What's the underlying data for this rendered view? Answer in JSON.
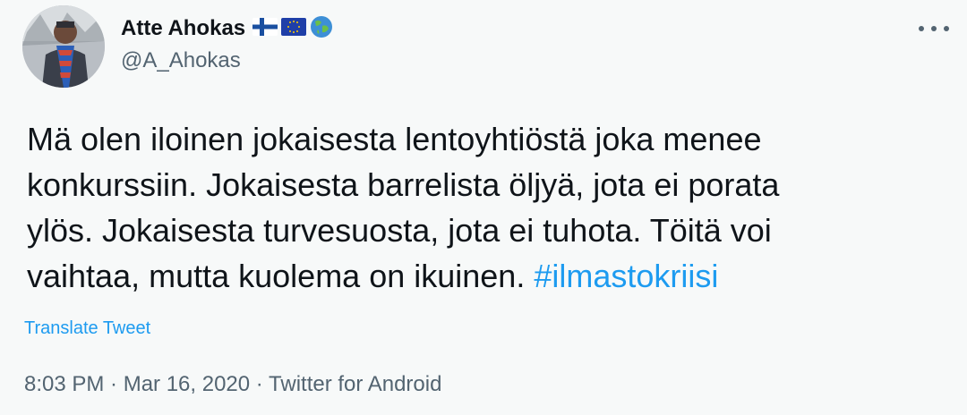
{
  "author": {
    "display_name": "Atte Ahokas",
    "handle": "@A_Ahokas",
    "badges": [
      "flag-finland-icon",
      "flag-eu-icon",
      "globe-icon"
    ]
  },
  "tweet": {
    "text_line1": "Mä olen iloinen jokaisesta lentoyhtiöstä joka menee",
    "text_line2": "konkurssiin. Jokaisesta barrelista öljyä, jota ei porata",
    "text_line3": "ylös. Jokaisesta turvesuosta, jota ei tuhota. Töitä voi",
    "text_line4_prefix": "vaihtaa, mutta kuolema on ikuinen. ",
    "hashtag": "#ilmastokriisi",
    "translate_label": "Translate Tweet",
    "meta": "8:03 PM · Mar 16, 2020 · Twitter for Android"
  },
  "colors": {
    "accent": "#1d9bf0",
    "secondary_text": "#536471",
    "background": "#f7f9f9"
  }
}
